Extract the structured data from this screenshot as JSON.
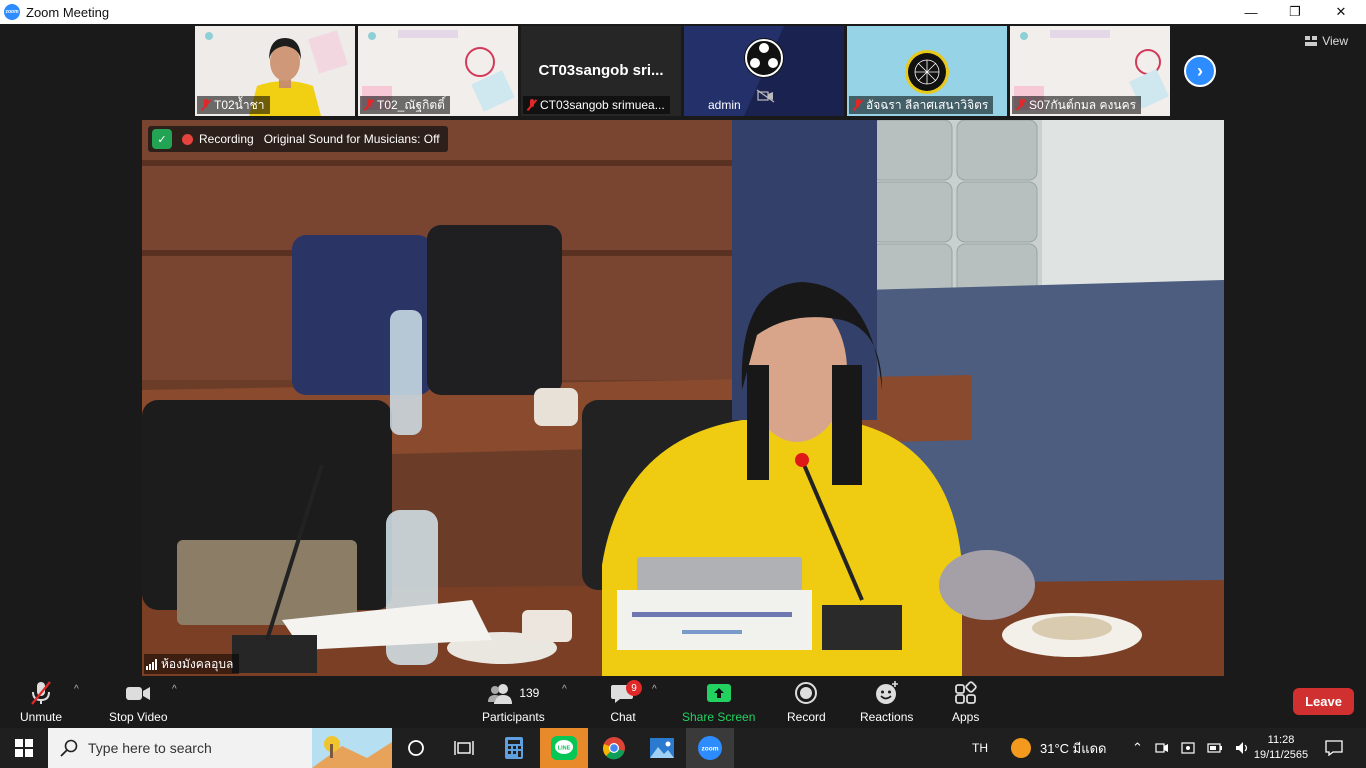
{
  "window": {
    "title": "Zoom Meeting",
    "minimize": "—",
    "restore": "❐",
    "close": "✕"
  },
  "gallery": {
    "view_label": "View",
    "participants": [
      {
        "name": "T02น้ำชา",
        "muted": true,
        "type": "video-person"
      },
      {
        "name": "T02_ณัฐกิตติ์",
        "muted": true,
        "type": "poster"
      },
      {
        "name": "CT03sangob srimuea...",
        "title": "CT03sangob  sri...",
        "muted": true,
        "type": "name-only"
      },
      {
        "name": "admin",
        "muted": false,
        "video_off": true,
        "type": "obs"
      },
      {
        "name": "อัจฉรา  ลีลาศเสนาวิจิตร",
        "muted": true,
        "type": "avatar"
      },
      {
        "name": "S07กันต์กมล คงนคร",
        "muted": true,
        "type": "poster"
      }
    ]
  },
  "main_video": {
    "recording_label": "Recording",
    "sound_label": "Original Sound for Musicians: Off",
    "speaker_name": "ห้องมังคลอุบล"
  },
  "toolbar": {
    "unmute_label": "Unmute",
    "stop_video_label": "Stop Video",
    "participants_label": "Participants",
    "participants_count": "139",
    "chat_label": "Chat",
    "chat_badge": "9",
    "share_label": "Share Screen",
    "record_label": "Record",
    "reactions_label": "Reactions",
    "apps_label": "Apps",
    "leave_label": "Leave"
  },
  "taskbar": {
    "search_placeholder": "Type here to search",
    "language": "TH",
    "weather": "31°C  มีแดด",
    "time": "11:28",
    "date": "19/11/2565"
  },
  "colors": {
    "accent": "#2d8cff",
    "leave": "#d0302f",
    "share": "#23d160",
    "muted": "#e02828"
  }
}
